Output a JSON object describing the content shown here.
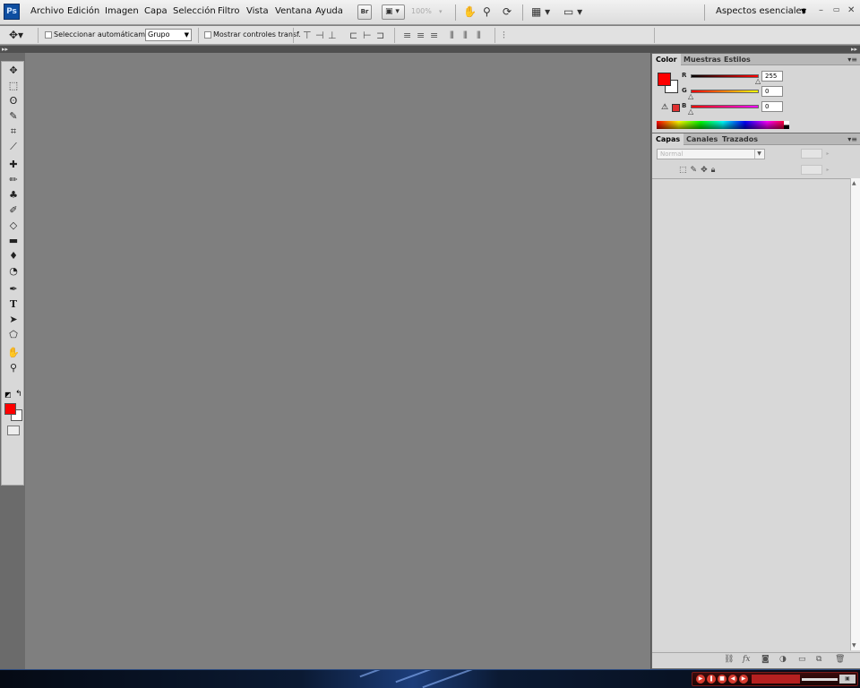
{
  "app": {
    "logo": "Ps"
  },
  "menu": [
    "Archivo",
    "Edición",
    "Imagen",
    "Capa",
    "Selección",
    "Filtro",
    "Vista",
    "Ventana",
    "Ayuda"
  ],
  "menubar": {
    "bridge_label": "Br",
    "zoom": "100%",
    "workspace": "Aspectos esenciales",
    "icons": [
      "bridge-icon",
      "view-extras-icon",
      "hand-icon",
      "zoom-icon",
      "rotate-view-icon",
      "arrange-documents-icon",
      "screen-mode-icon"
    ]
  },
  "options_bar": {
    "auto_select_label": "Seleccionar automáticamente:",
    "auto_select_value": "Grupo",
    "transform_controls_label": "Mostrar controles transf.",
    "auto_select_checked": false,
    "transform_controls_checked": false
  },
  "tools": [
    "move-tool",
    "marquee-tool",
    "lasso-tool",
    "quick-selection-tool",
    "crop-tool",
    "eyedropper-tool",
    "healing-brush-tool",
    "brush-tool",
    "clone-stamp-tool",
    "history-brush-tool",
    "eraser-tool",
    "gradient-tool",
    "blur-tool",
    "dodge-tool",
    "pen-tool",
    "type-tool",
    "path-selection-tool",
    "shape-tool",
    "hand-tool",
    "zoom-tool"
  ],
  "colors": {
    "foreground": "#ff0000",
    "background": "#ffffff"
  },
  "color_panel": {
    "tabs": [
      "Color",
      "Muestras",
      "Estilos"
    ],
    "active_tab": "Color",
    "sliders": [
      {
        "label": "R",
        "value": "255"
      },
      {
        "label": "G",
        "value": "0"
      },
      {
        "label": "B",
        "value": "0"
      }
    ]
  },
  "layers_panel": {
    "tabs": [
      "Capas",
      "Canales",
      "Trazados"
    ],
    "active_tab": "Capas",
    "blend_mode": "Normal"
  }
}
